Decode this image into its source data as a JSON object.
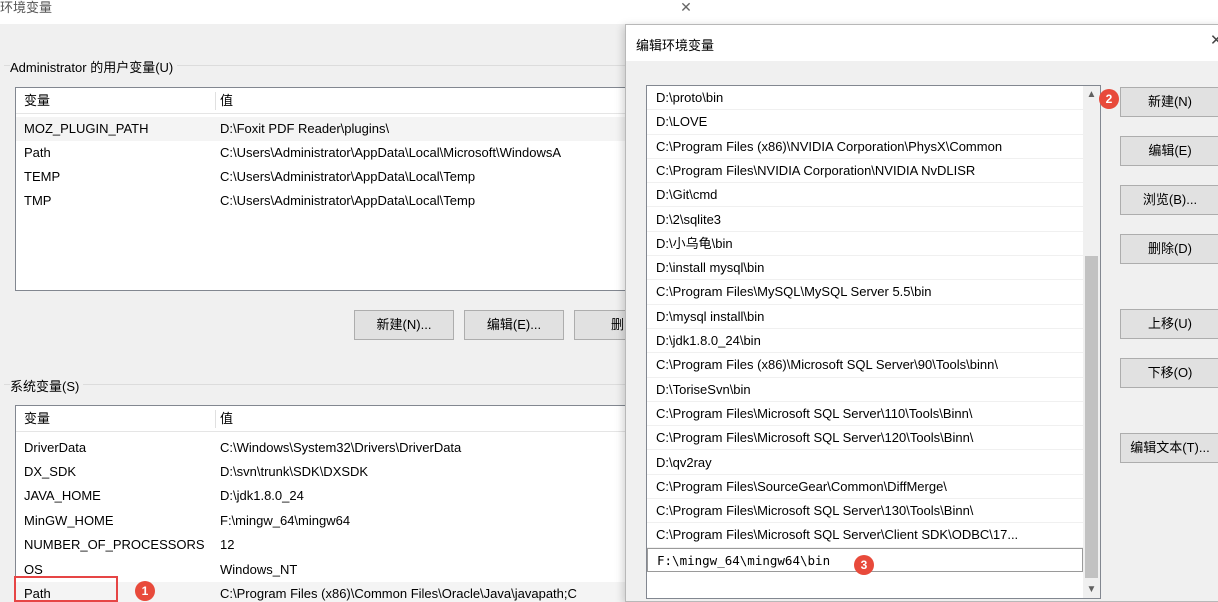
{
  "background_window": {
    "title": "环境变量",
    "user_section": {
      "label": "Administrator 的用户变量(U)",
      "headers": {
        "name": "变量",
        "value": "值"
      },
      "rows": [
        {
          "name": "MOZ_PLUGIN_PATH",
          "value": "D:\\Foxit PDF Reader\\plugins\\"
        },
        {
          "name": "Path",
          "value": "C:\\Users\\Administrator\\AppData\\Local\\Microsoft\\WindowsA"
        },
        {
          "name": "TEMP",
          "value": "C:\\Users\\Administrator\\AppData\\Local\\Temp"
        },
        {
          "name": "TMP",
          "value": "C:\\Users\\Administrator\\AppData\\Local\\Temp"
        }
      ],
      "buttons": {
        "new": "新建(N)...",
        "edit": "编辑(E)...",
        "delete": "删除"
      }
    },
    "system_section": {
      "label": "系统变量(S)",
      "headers": {
        "name": "变量",
        "value": "值"
      },
      "rows": [
        {
          "name": "DriverData",
          "value": "C:\\Windows\\System32\\Drivers\\DriverData"
        },
        {
          "name": "DX_SDK",
          "value": "D:\\svn\\trunk\\SDK\\DXSDK"
        },
        {
          "name": "JAVA_HOME",
          "value": "D:\\jdk1.8.0_24"
        },
        {
          "name": "MinGW_HOME",
          "value": "F:\\mingw_64\\mingw64"
        },
        {
          "name": "NUMBER_OF_PROCESSORS",
          "value": "12"
        },
        {
          "name": "OS",
          "value": "Windows_NT"
        },
        {
          "name": "Path",
          "value": "C:\\Program Files (x86)\\Common Files\\Oracle\\Java\\javapath;C"
        }
      ]
    }
  },
  "badges": {
    "one": "1",
    "two": "2",
    "three": "3"
  },
  "dialog": {
    "title": "编辑环境变量",
    "paths": [
      "D:\\proto\\bin",
      "D:\\LOVE",
      "C:\\Program Files (x86)\\NVIDIA Corporation\\PhysX\\Common",
      "C:\\Program Files\\NVIDIA Corporation\\NVIDIA NvDLISR",
      "D:\\Git\\cmd",
      "D:\\2\\sqlite3",
      "D:\\小乌龟\\bin",
      "D:\\install mysql\\bin",
      "C:\\Program Files\\MySQL\\MySQL Server 5.5\\bin",
      "D:\\mysql install\\bin",
      "D:\\jdk1.8.0_24\\bin",
      "C:\\Program Files (x86)\\Microsoft SQL Server\\90\\Tools\\binn\\",
      "D:\\ToriseSvn\\bin",
      "C:\\Program Files\\Microsoft SQL Server\\110\\Tools\\Binn\\",
      "C:\\Program Files\\Microsoft SQL Server\\120\\Tools\\Binn\\",
      "D:\\qv2ray",
      "C:\\Program Files\\SourceGear\\Common\\DiffMerge\\",
      "C:\\Program Files\\Microsoft SQL Server\\130\\Tools\\Binn\\",
      "C:\\Program Files\\Microsoft SQL Server\\Client SDK\\ODBC\\17...",
      "F:\\mingw_64\\mingw64\\bin"
    ],
    "buttons": {
      "new": "新建(N)",
      "edit": "编辑(E)",
      "browse": "浏览(B)...",
      "delete": "删除(D)",
      "move_up": "上移(U)",
      "move_down": "下移(O)",
      "edit_text": "编辑文本(T)..."
    }
  },
  "colors": {
    "badge": "#e84a3b",
    "highlight": "#e64545"
  },
  "icons": {
    "close": "close-icon",
    "scroll_up": "chevron-up-icon",
    "scroll_down": "chevron-down-icon"
  }
}
